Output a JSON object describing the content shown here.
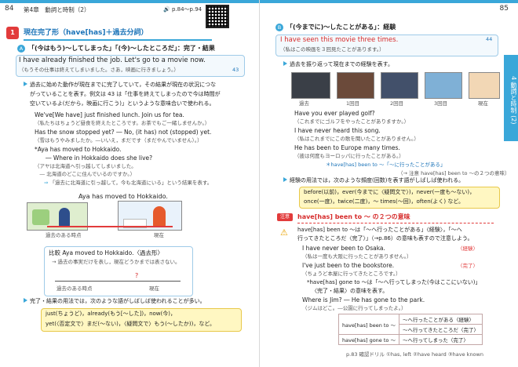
{
  "left_page": {
    "page_number": "84",
    "chapter": "第4章　動詞と時制（2）",
    "ref": "p.84～p.94",
    "section_number": "1",
    "section_title": "現在完了形（have[has]＋過去分詞）",
    "sub_a_title": "「(今はもう)～してしまった」「(今)～したところだ」：完了・結果",
    "ex1_en": "I have already finished the job.  Let's go to a movie now.",
    "ex1_ja": "（もうその仕事は終えてしまいました。さあ，映画に行きましょう。）",
    "ex1_num": "43",
    "para1_l1": "過去に始めた動作が現在までに完了していて，その結果が現在の状況につな",
    "para1_l2": "がっていることを表す。例文は 43 は「仕事を終えてしまったので今は時間が",
    "para1_l3": "空いているよ(だから，映画に行こう)」というような意味合いで使われる。",
    "s1_en": "We've[We have] just finished lunch.  Join us for tea.",
    "s1_ja": "（私たちはちょうど昼食を終えたところです。お茶でもご一緒しませんか。）",
    "s2_en": "Has the snow stopped yet? ― No, (it has) not (stopped) yet.",
    "s2_ja": "（雪はもうやみましたか。―いいえ，まだです（まだやんでいません）。）",
    "s3_en": "*Aya has moved to Hokkaido.",
    "s3_en2": "― Where in Hokkaido does she live?",
    "s3_ja": "（アヤは北海道へ引っ越してしまいました。",
    "s3_ja2": "　― 北海道のどこに住んでいるのですか。）",
    "note_text": "「過去に北海道に引っ越して，今も北海道にいる」という結果を表す。",
    "figure_caption": "Aya has moved to Hokkaido.",
    "fig_label_past": "過去のある時点",
    "fig_label_now": "現在",
    "compare_title": "比較 Aya moved to Hokkaido.〈過去形〉",
    "compare_note": "→ 過去の事実だけを表し，現在どうかまでは表さない。",
    "compare_past": "過去のある時点",
    "compare_now": "現在",
    "compare_q": "?",
    "adv_lead": "完了・結果の用法では，次のような語がしばしば使われることが多い。",
    "adv_l1": "just(ちょうど)，already(もう[～した])，now(今)，",
    "adv_l2": "yet(〈否定文で〉まだ(～ない)，〈疑問文で〉もう(～したか))，など。"
  },
  "right_page": {
    "page_number": "85",
    "sub_b_title": "「(今までに)～したことがある」：経験",
    "ex2_en": "I have seen this movie three times.",
    "ex2_ja": "（私はこの映画を３回見たことがあります。）",
    "ex2_num": "44",
    "para2": "過去を振り返って現在までの経験を表す。",
    "image_labels": [
      "過去",
      "1回目",
      "2回目",
      "3回目",
      "現在"
    ],
    "r1_en": "Have you ever played golf?",
    "r1_ja": "（これまでにゴルフをやったことがありますか。）",
    "r2_en": "I have never heard this song.",
    "r2_ja": "（私はこれまでにこの歌を聞いたことがありません。）",
    "r3_en": "He has been to Europe many times.",
    "r3_ja": "（彼は何度もヨーロッパに行ったことがある。）",
    "been_note": "have[has] been to ～「～に行ったことがある」",
    "ref_note": "（→ 注意 have[has] been to ～の２つの意味）",
    "para3": "経験の用法では，次のような頻度(回数)を表す語がしばしば使われる。",
    "freq_l1": "before(以前)，ever(今までに〈疑問文で〉)，never(一度も～ない)，",
    "freq_l2": "once(一度)，twice(二度)，～ times(～回)，often(よく) など。",
    "caution_label": "注意",
    "caution_title": "have[has] been to ～ の２つの意味",
    "c1": "have[has] been to ～は「～へ行ったことがある」〈経験〉，「～へ",
    "c2": "行ってきたところだ〈完了〉」（→p.86）の意味も表すので注意しよう。",
    "c3_en": "I have never been to Osaka.",
    "c3_tag": "〈経験〉",
    "c3_ja": "（私は一度も大阪に行ったことがありません。）",
    "c4_en": "I've just been to the bookstore.",
    "c4_tag": "〈完了〉",
    "c4_ja": "（ちょうど本屋に行ってきたところです。）",
    "c5": "*have[has] gone to ～は「～へ行ってしまった(今はここにいない)」",
    "c5b": "〈完了・結果〉の意味を表す。",
    "c6_en": "Where is Jim? ― He has gone to the park.",
    "c6_ja": "（ジムはどこ。―公園に行ってしまったよ。）",
    "table_left": "have[has] been to ～",
    "table_left2": "have[has] gone to ～",
    "table_rows": [
      "～へ行ったことがある〈経験〉",
      "～へ行ってきたところだ〈完了〉",
      "～へ行ってしまった〈完了〉"
    ],
    "footer": "p.83 確認ドリル ①has, left  ②have heard  ③have known",
    "side_tab": "4 動詞と時制 (2)"
  }
}
